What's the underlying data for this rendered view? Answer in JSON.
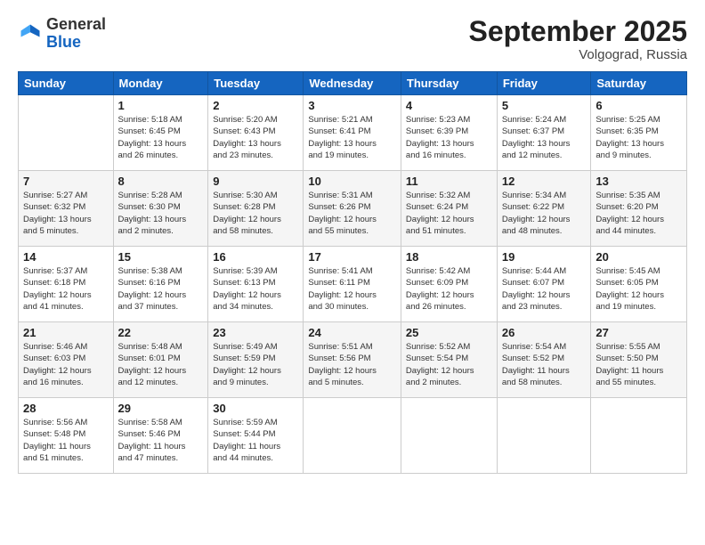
{
  "header": {
    "logo_general": "General",
    "logo_blue": "Blue",
    "month_title": "September 2025",
    "location": "Volgograd, Russia"
  },
  "columns": [
    "Sunday",
    "Monday",
    "Tuesday",
    "Wednesday",
    "Thursday",
    "Friday",
    "Saturday"
  ],
  "weeks": [
    [
      {
        "day": "",
        "info": ""
      },
      {
        "day": "1",
        "info": "Sunrise: 5:18 AM\nSunset: 6:45 PM\nDaylight: 13 hours\nand 26 minutes."
      },
      {
        "day": "2",
        "info": "Sunrise: 5:20 AM\nSunset: 6:43 PM\nDaylight: 13 hours\nand 23 minutes."
      },
      {
        "day": "3",
        "info": "Sunrise: 5:21 AM\nSunset: 6:41 PM\nDaylight: 13 hours\nand 19 minutes."
      },
      {
        "day": "4",
        "info": "Sunrise: 5:23 AM\nSunset: 6:39 PM\nDaylight: 13 hours\nand 16 minutes."
      },
      {
        "day": "5",
        "info": "Sunrise: 5:24 AM\nSunset: 6:37 PM\nDaylight: 13 hours\nand 12 minutes."
      },
      {
        "day": "6",
        "info": "Sunrise: 5:25 AM\nSunset: 6:35 PM\nDaylight: 13 hours\nand 9 minutes."
      }
    ],
    [
      {
        "day": "7",
        "info": "Sunrise: 5:27 AM\nSunset: 6:32 PM\nDaylight: 13 hours\nand 5 minutes."
      },
      {
        "day": "8",
        "info": "Sunrise: 5:28 AM\nSunset: 6:30 PM\nDaylight: 13 hours\nand 2 minutes."
      },
      {
        "day": "9",
        "info": "Sunrise: 5:30 AM\nSunset: 6:28 PM\nDaylight: 12 hours\nand 58 minutes."
      },
      {
        "day": "10",
        "info": "Sunrise: 5:31 AM\nSunset: 6:26 PM\nDaylight: 12 hours\nand 55 minutes."
      },
      {
        "day": "11",
        "info": "Sunrise: 5:32 AM\nSunset: 6:24 PM\nDaylight: 12 hours\nand 51 minutes."
      },
      {
        "day": "12",
        "info": "Sunrise: 5:34 AM\nSunset: 6:22 PM\nDaylight: 12 hours\nand 48 minutes."
      },
      {
        "day": "13",
        "info": "Sunrise: 5:35 AM\nSunset: 6:20 PM\nDaylight: 12 hours\nand 44 minutes."
      }
    ],
    [
      {
        "day": "14",
        "info": "Sunrise: 5:37 AM\nSunset: 6:18 PM\nDaylight: 12 hours\nand 41 minutes."
      },
      {
        "day": "15",
        "info": "Sunrise: 5:38 AM\nSunset: 6:16 PM\nDaylight: 12 hours\nand 37 minutes."
      },
      {
        "day": "16",
        "info": "Sunrise: 5:39 AM\nSunset: 6:13 PM\nDaylight: 12 hours\nand 34 minutes."
      },
      {
        "day": "17",
        "info": "Sunrise: 5:41 AM\nSunset: 6:11 PM\nDaylight: 12 hours\nand 30 minutes."
      },
      {
        "day": "18",
        "info": "Sunrise: 5:42 AM\nSunset: 6:09 PM\nDaylight: 12 hours\nand 26 minutes."
      },
      {
        "day": "19",
        "info": "Sunrise: 5:44 AM\nSunset: 6:07 PM\nDaylight: 12 hours\nand 23 minutes."
      },
      {
        "day": "20",
        "info": "Sunrise: 5:45 AM\nSunset: 6:05 PM\nDaylight: 12 hours\nand 19 minutes."
      }
    ],
    [
      {
        "day": "21",
        "info": "Sunrise: 5:46 AM\nSunset: 6:03 PM\nDaylight: 12 hours\nand 16 minutes."
      },
      {
        "day": "22",
        "info": "Sunrise: 5:48 AM\nSunset: 6:01 PM\nDaylight: 12 hours\nand 12 minutes."
      },
      {
        "day": "23",
        "info": "Sunrise: 5:49 AM\nSunset: 5:59 PM\nDaylight: 12 hours\nand 9 minutes."
      },
      {
        "day": "24",
        "info": "Sunrise: 5:51 AM\nSunset: 5:56 PM\nDaylight: 12 hours\nand 5 minutes."
      },
      {
        "day": "25",
        "info": "Sunrise: 5:52 AM\nSunset: 5:54 PM\nDaylight: 12 hours\nand 2 minutes."
      },
      {
        "day": "26",
        "info": "Sunrise: 5:54 AM\nSunset: 5:52 PM\nDaylight: 11 hours\nand 58 minutes."
      },
      {
        "day": "27",
        "info": "Sunrise: 5:55 AM\nSunset: 5:50 PM\nDaylight: 11 hours\nand 55 minutes."
      }
    ],
    [
      {
        "day": "28",
        "info": "Sunrise: 5:56 AM\nSunset: 5:48 PM\nDaylight: 11 hours\nand 51 minutes."
      },
      {
        "day": "29",
        "info": "Sunrise: 5:58 AM\nSunset: 5:46 PM\nDaylight: 11 hours\nand 47 minutes."
      },
      {
        "day": "30",
        "info": "Sunrise: 5:59 AM\nSunset: 5:44 PM\nDaylight: 11 hours\nand 44 minutes."
      },
      {
        "day": "",
        "info": ""
      },
      {
        "day": "",
        "info": ""
      },
      {
        "day": "",
        "info": ""
      },
      {
        "day": "",
        "info": ""
      }
    ]
  ]
}
